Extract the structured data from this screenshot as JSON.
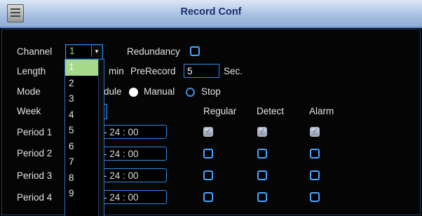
{
  "window": {
    "title": "Record Conf"
  },
  "form": {
    "channel_label": "Channel",
    "channel_value": "1",
    "redundancy_label": "Redundancy",
    "length_label": "Length",
    "length_unit": "min",
    "prerecord_label": "PreRecord",
    "prerecord_value": "5",
    "prerecord_unit": "Sec.",
    "mode_label": "Mode",
    "mode_schedule_partial": "dule",
    "mode_manual": "Manual",
    "mode_stop": "Stop",
    "week_label": "Week"
  },
  "columns": {
    "regular": "Regular",
    "detect": "Detect",
    "alarm": "Alarm"
  },
  "periods": [
    {
      "label": "Period 1",
      "time": "-   24 : 00",
      "regular": true,
      "detect": true,
      "alarm": true
    },
    {
      "label": "Period 2",
      "time": "-   24 : 00",
      "regular": false,
      "detect": false,
      "alarm": false
    },
    {
      "label": "Period 3",
      "time": "-   24 : 00",
      "regular": false,
      "detect": false,
      "alarm": false
    },
    {
      "label": "Period 4",
      "time": "-   24 : 00",
      "regular": false,
      "detect": false,
      "alarm": false
    }
  ],
  "channel_dropdown": {
    "options": [
      "1",
      "2",
      "3",
      "4",
      "5",
      "6",
      "7",
      "8",
      "9"
    ],
    "selected": "1"
  },
  "icons": {
    "dropdown_arrow": "▾",
    "app_icon": "app-icon"
  },
  "colors": {
    "accent": "#2e8be6",
    "title_text": "#1c2d6c",
    "selected": "#a7d98a"
  }
}
